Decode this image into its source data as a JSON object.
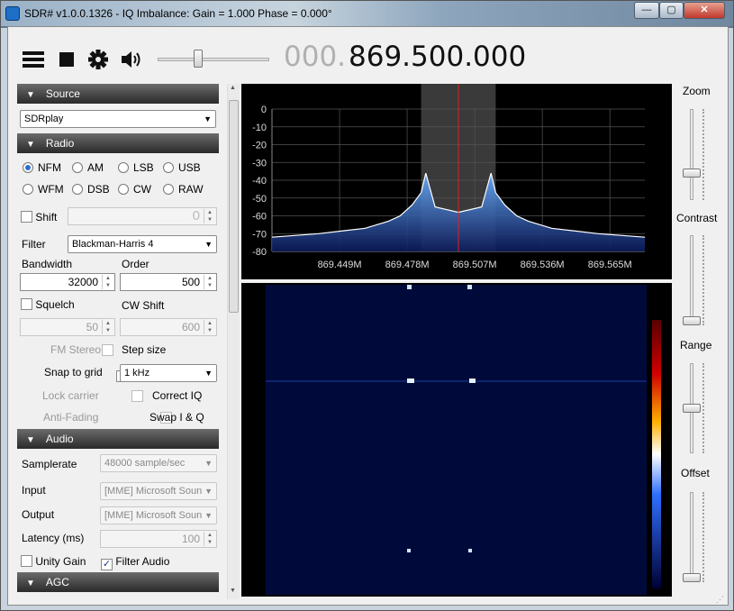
{
  "window": {
    "title": "SDR# v1.0.0.1326 - IQ Imbalance: Gain = 1.000 Phase = 0.000°",
    "minimize": "—",
    "maximize": "▢",
    "close": "✕"
  },
  "toolbar": {
    "freq_dim": "000.",
    "frequency": "869.500.000"
  },
  "source": {
    "header": "Source",
    "device": "SDRplay"
  },
  "radio": {
    "header": "Radio",
    "modes": [
      {
        "label": "NFM",
        "selected": true
      },
      {
        "label": "AM",
        "selected": false
      },
      {
        "label": "LSB",
        "selected": false
      },
      {
        "label": "USB",
        "selected": false
      },
      {
        "label": "WFM",
        "selected": false
      },
      {
        "label": "DSB",
        "selected": false
      },
      {
        "label": "CW",
        "selected": false
      },
      {
        "label": "RAW",
        "selected": false
      }
    ],
    "shift_label": "Shift",
    "shift_value": "0",
    "filter_label": "Filter",
    "filter_value": "Blackman-Harris 4",
    "bandwidth_label": "Bandwidth",
    "bandwidth_value": "32000",
    "order_label": "Order",
    "order_value": "500",
    "squelch_label": "Squelch",
    "squelch_value": "50",
    "cwshift_label": "CW Shift",
    "cwshift_value": "600",
    "fmstereo_label": "FM Stereo",
    "stepsize_label": "Step size",
    "snap_label": "Snap to grid",
    "step_value": "1 kHz",
    "lockcarrier_label": "Lock carrier",
    "correctiq_label": "Correct IQ",
    "antifading_label": "Anti-Fading",
    "swapiq_label": "Swap I & Q"
  },
  "audio": {
    "header": "Audio",
    "samplerate_label": "Samplerate",
    "samplerate_value": "48000 sample/sec",
    "input_label": "Input",
    "input_value": "[MME] Microsoft Soun",
    "output_label": "Output",
    "output_value": "[MME] Microsoft Soun",
    "latency_label": "Latency (ms)",
    "latency_value": "100",
    "unitygain_label": "Unity Gain",
    "filteraudio_label": "Filter Audio"
  },
  "agc": {
    "header": "AGC"
  },
  "right_panel": {
    "zoom": "Zoom",
    "contrast": "Contrast",
    "range": "Range",
    "offset": "Offset",
    "zoom_level": 0.28,
    "contrast_level": 0.0,
    "range_level": 0.5,
    "offset_level": 0.0
  },
  "chart_data": {
    "type": "line",
    "xlabel": "",
    "ylabel": "",
    "yticks": [
      "0",
      "-10",
      "-20",
      "-30",
      "-40",
      "-50",
      "-60",
      "-70",
      "-80"
    ],
    "ylim": [
      -80,
      0
    ],
    "xticks": [
      "869.449M",
      "869.478M",
      "869.507M",
      "869.536M",
      "869.565M"
    ],
    "xlim": [
      869.42,
      869.58
    ],
    "center": 869.5,
    "filter_band": [
      869.484,
      869.516
    ],
    "series": [
      {
        "x": [
          869.42,
          869.44,
          869.46,
          869.47,
          869.475,
          869.48,
          869.484,
          869.486,
          869.49,
          869.5,
          869.51,
          869.514,
          869.516,
          869.52,
          869.525,
          869.53,
          869.54,
          869.56,
          869.58
        ],
        "values": [
          -72,
          -70,
          -67,
          -63,
          -60,
          -54,
          -47,
          -36,
          -55,
          -58,
          -55,
          -36,
          -47,
          -54,
          -60,
          -63,
          -67,
          -70,
          -72
        ]
      }
    ]
  }
}
